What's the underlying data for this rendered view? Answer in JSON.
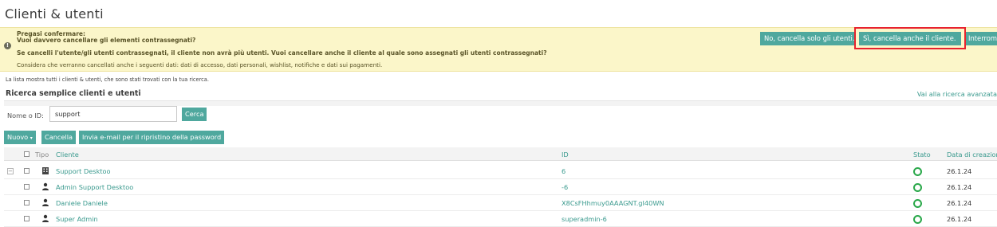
{
  "page": {
    "title": "Clienti & utenti"
  },
  "confirm": {
    "heading": "Pregasi confermare:",
    "question": "Vuoi davvero cancellare gli elementi contrassegnati?",
    "detail": "Se cancelli l'utente/gli utenti contrassegnati, il cliente non avrà più utenti. Vuoi cancellare anche il cliente al quale sono assegnati gli utenti contrassegnati?",
    "note": "Considera che verranno cancellati anche i seguenti dati: dati di accesso, dati personali, wishlist, notifiche e dati sui pagamenti.",
    "buttons": {
      "no": "No, cancella solo gli utenti.",
      "yes": "Sì, cancella anche il cliente.",
      "abort": "Interrompi"
    }
  },
  "info": {
    "text": "La lista mostra tutti i clienti & utenti, che sono stati trovati con la tua ricerca."
  },
  "search": {
    "title": "Ricerca semplice clienti e utenti",
    "advanced_link": "Vai alla ricerca avanzata",
    "label": "Nome o ID:",
    "value": "support",
    "button": "Cerca"
  },
  "toolbar": {
    "new": "Nuovo",
    "delete": "Cancella",
    "reset_password": "Invia e-mail per il ripristino della password"
  },
  "table": {
    "headers": {
      "type": "Tipo",
      "customer": "Cliente",
      "id": "ID",
      "status": "Stato",
      "created": "Data di creazione"
    },
    "rows": [
      {
        "type_icon": "group-icon",
        "name": "Support Desktoo",
        "id": "6",
        "status": "active",
        "created": "26.1.24"
      },
      {
        "type_icon": "user-icon",
        "name": "Admin Support Desktoo",
        "id": "-6",
        "status": "active",
        "created": "26.1.24"
      },
      {
        "type_icon": "user-icon",
        "name": "Daniele Daniele",
        "id": "X8CsFHhmuy0AAAGNT.gI40WN",
        "status": "active",
        "created": "26.1.24"
      },
      {
        "type_icon": "user-icon",
        "name": "Super Admin",
        "id": "superadmin-6",
        "status": "active",
        "created": "26.1.24"
      }
    ]
  },
  "colors": {
    "accent": "#4fa89e",
    "link": "#3a9a8e",
    "confirm_bg": "#fbf6c9",
    "highlight": "#e8222e",
    "status_ok": "#2aa84a"
  }
}
